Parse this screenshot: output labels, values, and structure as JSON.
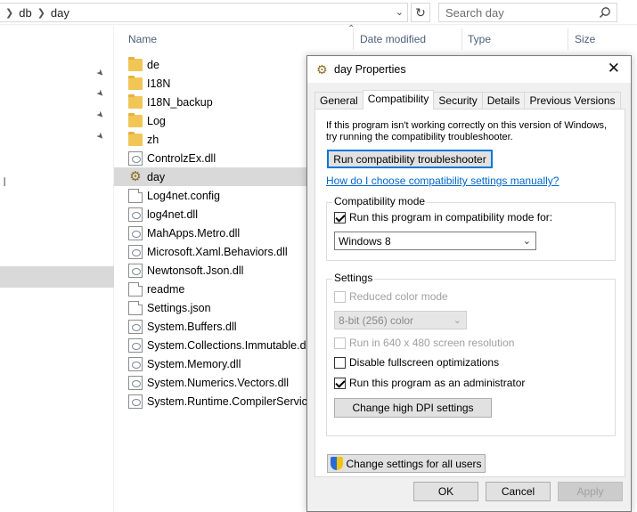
{
  "explorer": {
    "breadcrumb": [
      "db",
      "day"
    ],
    "search_placeholder": "Search day",
    "nav_glyph": "ㅣ",
    "columns": {
      "name": "Name",
      "date_modified": "Date modified",
      "type": "Type",
      "size": "Size"
    },
    "files": [
      {
        "name": "de",
        "kind": "folder"
      },
      {
        "name": "I18N",
        "kind": "folder"
      },
      {
        "name": "I18N_backup",
        "kind": "folder"
      },
      {
        "name": "Log",
        "kind": "folder"
      },
      {
        "name": "zh",
        "kind": "folder"
      },
      {
        "name": "ControlzEx.dll",
        "kind": "dll"
      },
      {
        "name": "day",
        "kind": "exe",
        "selected": true
      },
      {
        "name": "Log4net.config",
        "kind": "doc"
      },
      {
        "name": "log4net.dll",
        "kind": "dll"
      },
      {
        "name": "MahApps.Metro.dll",
        "kind": "dll"
      },
      {
        "name": "Microsoft.Xaml.Behaviors.dll",
        "kind": "dll"
      },
      {
        "name": "Newtonsoft.Json.dll",
        "kind": "dll"
      },
      {
        "name": "readme",
        "kind": "doc"
      },
      {
        "name": "Settings.json",
        "kind": "doc"
      },
      {
        "name": "System.Buffers.dll",
        "kind": "dll"
      },
      {
        "name": "System.Collections.Immutable.dll",
        "kind": "dll"
      },
      {
        "name": "System.Memory.dll",
        "kind": "dll"
      },
      {
        "name": "System.Numerics.Vectors.dll",
        "kind": "dll"
      },
      {
        "name": "System.Runtime.CompilerServices",
        "kind": "dll"
      }
    ]
  },
  "dialog": {
    "title": "day Properties",
    "tabs": [
      "General",
      "Compatibility",
      "Security",
      "Details",
      "Previous Versions"
    ],
    "active_tab": "Compatibility",
    "intro_line1": "If this program isn't working correctly on this version of Windows,",
    "intro_line2": "try running the compatibility troubleshooter.",
    "run_troubleshooter_label": "Run compatibility troubleshooter",
    "manual_link": "How do I choose compatibility settings manually?",
    "compat_mode": {
      "group_title": "Compatibility mode",
      "checkbox_label": "Run this program in compatibility mode for:",
      "checked": true,
      "selected_os": "Windows 8"
    },
    "settings": {
      "group_title": "Settings",
      "reduced_color_label": "Reduced color mode",
      "color_depth_value": "8-bit (256) color",
      "run_640_label": "Run in 640 x 480 screen resolution",
      "disable_fullscreen_label": "Disable fullscreen optimizations",
      "run_admin_label": "Run this program as an administrator",
      "high_dpi_label": "Change high DPI settings"
    },
    "change_all_users_label": "Change settings for all users",
    "ok_label": "OK",
    "cancel_label": "Cancel",
    "apply_label": "Apply"
  },
  "colors": {
    "link": "#0066cc",
    "focus": "#0078d7",
    "selection": "#d9d9d9",
    "folder": "#f2c656",
    "header_text": "#4c607a"
  }
}
